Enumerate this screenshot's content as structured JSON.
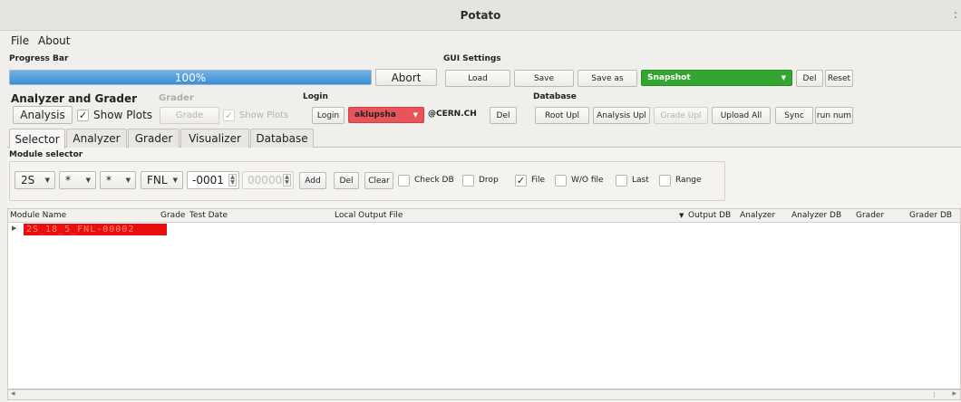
{
  "window": {
    "title": "Potato",
    "close_glyph": ":"
  },
  "menubar": {
    "file": "File",
    "about": "About"
  },
  "progress": {
    "section": "Progress Bar",
    "percent_text": "100%",
    "value": 1.0,
    "abort": "Abort"
  },
  "gui_settings": {
    "section": "GUI Settings",
    "load": "Load",
    "save": "Save",
    "save_as": "Save as",
    "snapshot": "Snapshot",
    "del": "Del",
    "reset": "Reset"
  },
  "analyzer": {
    "section": "Analyzer and Grader",
    "analysis": "Analysis",
    "show_plots": "Show Plots"
  },
  "grader": {
    "section": "Grader",
    "grade": "Grade",
    "show_plots": "Show Plots"
  },
  "login": {
    "section": "Login",
    "login_btn": "Login",
    "user": "aklupsha",
    "domain": "@CERN.CH",
    "del": "Del"
  },
  "database": {
    "section": "Database",
    "root_upl": "Root Upl",
    "analysis_upl": "Analysis Upl",
    "grade_upl": "Grade Upl",
    "upload_all": "Upload All",
    "sync": "Sync",
    "run_num": "run num"
  },
  "tabs": [
    "Selector",
    "Analyzer",
    "Grader",
    "Visualizer",
    "Database"
  ],
  "module_selector": {
    "section": "Module selector",
    "combo1": "2S",
    "combo2": "*",
    "combo3": "*",
    "combo4": "FNL",
    "spin1": "-0001",
    "spin2": "00000",
    "add": "Add",
    "del": "Del",
    "clear": "Clear",
    "check_db": "Check DB",
    "drop": "Drop",
    "file": "File",
    "wo_file": "W/O file",
    "last": "Last",
    "range": "Range"
  },
  "table": {
    "headers": [
      "Module Name",
      "Grade",
      "Test Date",
      "Local Output File",
      "Output DB",
      "Analyzer",
      "Analyzer DB",
      "Grader",
      "Grader DB"
    ],
    "rows": [
      {
        "module_name": "2S_18_5_FNL-00002"
      }
    ]
  },
  "colors": {
    "progress": "#3b8fd3",
    "snapshot": "#33a632",
    "user": "#e8545b",
    "module_highlight": "#ea0e0e"
  }
}
